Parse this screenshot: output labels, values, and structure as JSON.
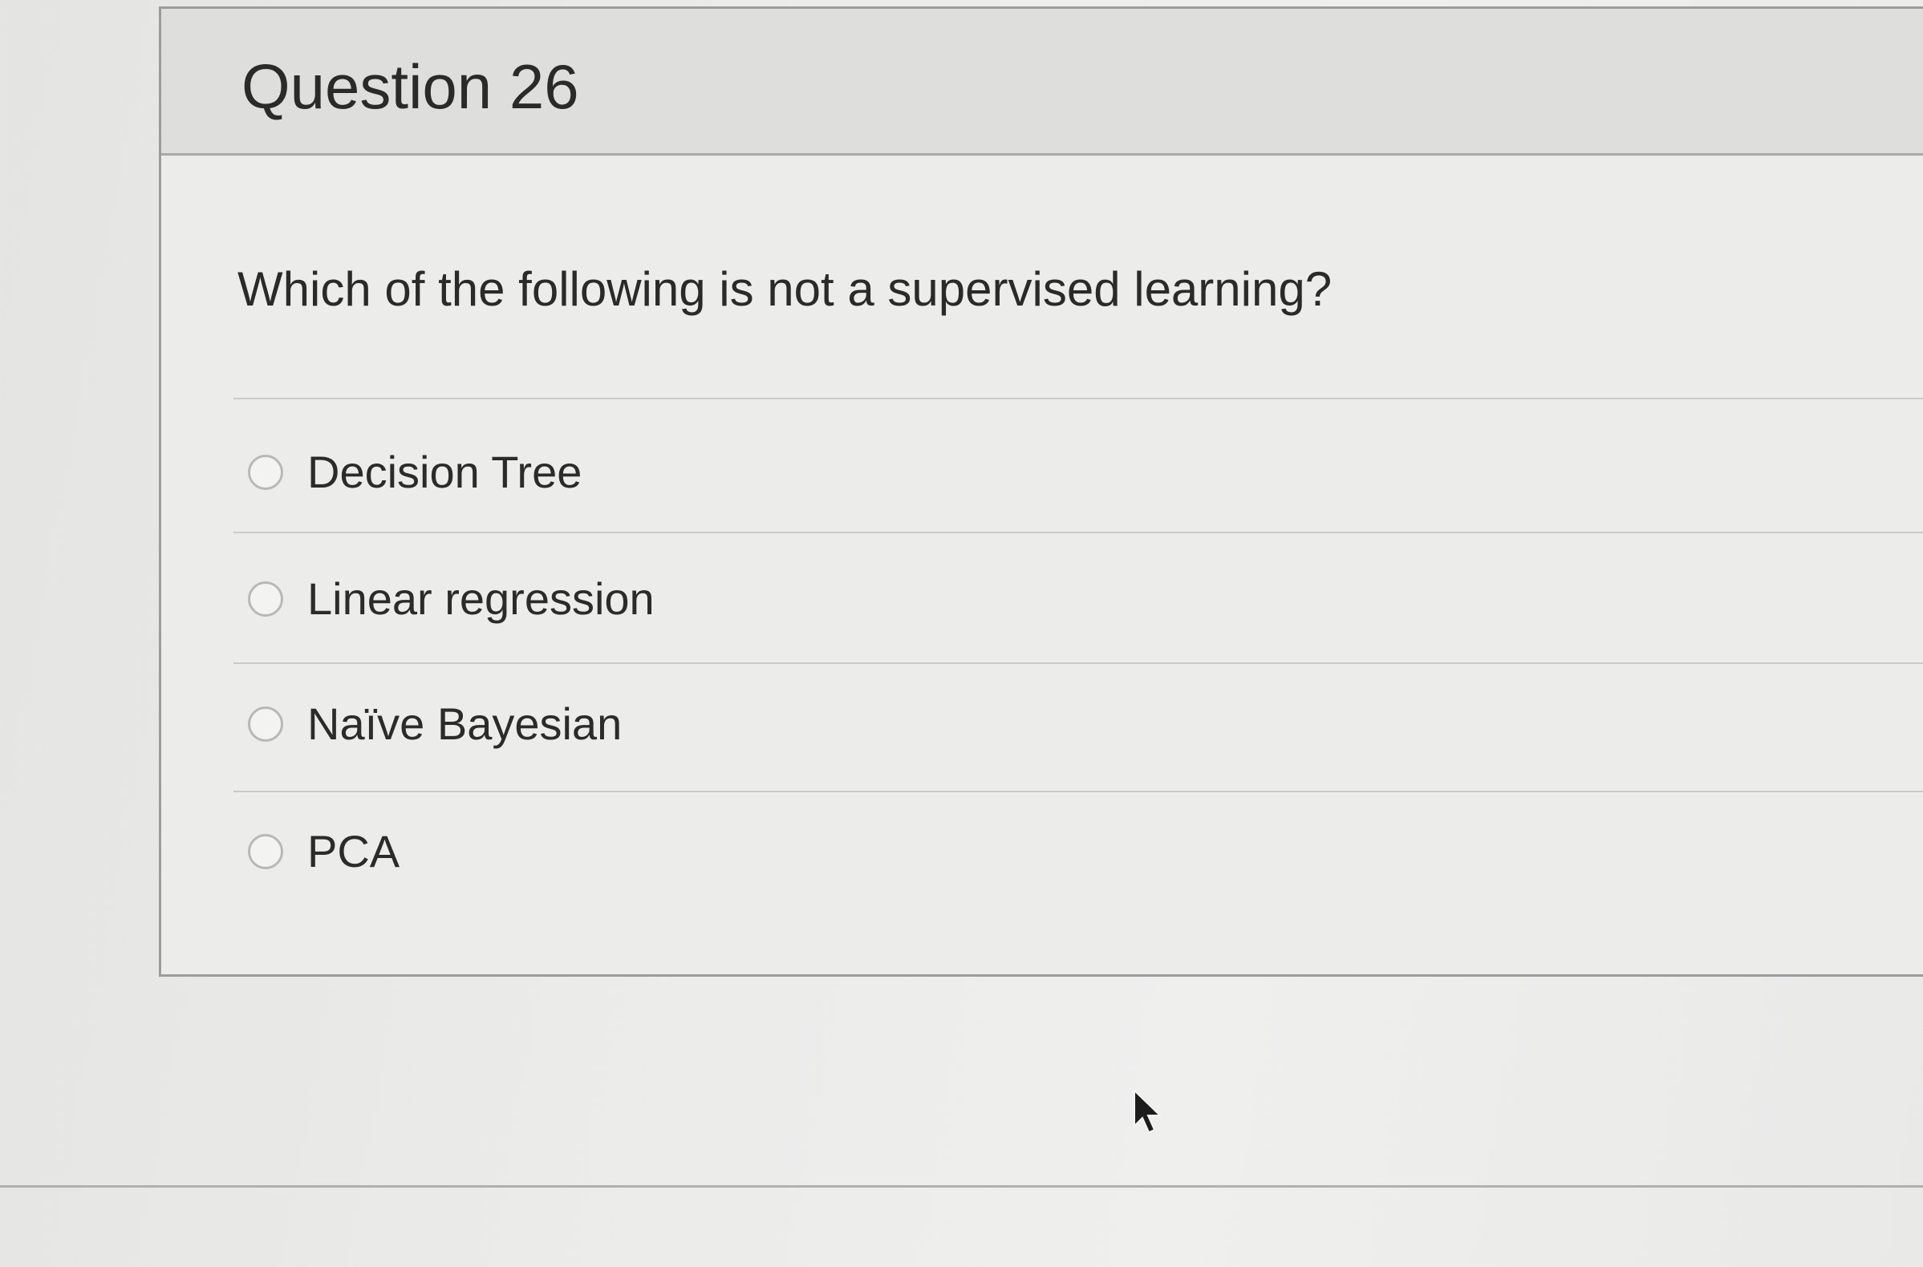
{
  "question": {
    "title": "Question 26",
    "prompt": "Which of the following is not a supervised learning?",
    "options": [
      {
        "label": "Decision Tree",
        "selected": false
      },
      {
        "label": "Linear regression",
        "selected": false
      },
      {
        "label": "Naïve Bayesian",
        "selected": false
      },
      {
        "label": "PCA",
        "selected": false
      }
    ]
  },
  "icons": {
    "radio": "radio-button-empty",
    "cursor": "mouse-pointer-arrow"
  },
  "colors": {
    "header_background": "#dededd",
    "card_background": "#ececeb",
    "text": "#2a2a2a",
    "border": "#9c9c9c"
  }
}
